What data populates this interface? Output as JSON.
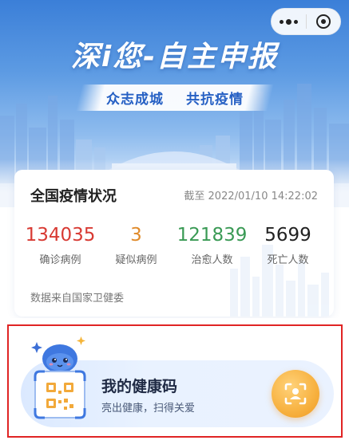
{
  "capsule": {
    "more_icon": "more-dots-icon",
    "close_icon": "close-circle-icon"
  },
  "header": {
    "title": "深i您-自主申报",
    "slogan_left": "众志成城",
    "slogan_right": "共抗疫情"
  },
  "stats_card": {
    "title": "全国疫情状况",
    "updated": "截至 2022/01/10 14:22:02",
    "items": [
      {
        "value": "134035",
        "label": "确诊病例",
        "color": "#d83a33"
      },
      {
        "value": "3",
        "label": "疑似病例",
        "color": "#e08a2a"
      },
      {
        "value": "121839",
        "label": "治愈人数",
        "color": "#3a9a55"
      },
      {
        "value": "5699",
        "label": "死亡人数",
        "color": "#222222"
      }
    ],
    "source": "数据来自国家卫健委"
  },
  "health_code": {
    "title": "我的健康码",
    "subtitle": "亮出健康，扫得关爱",
    "button_icon": "person-scan-icon",
    "mascot_icon": "mascot-qr-icon"
  }
}
